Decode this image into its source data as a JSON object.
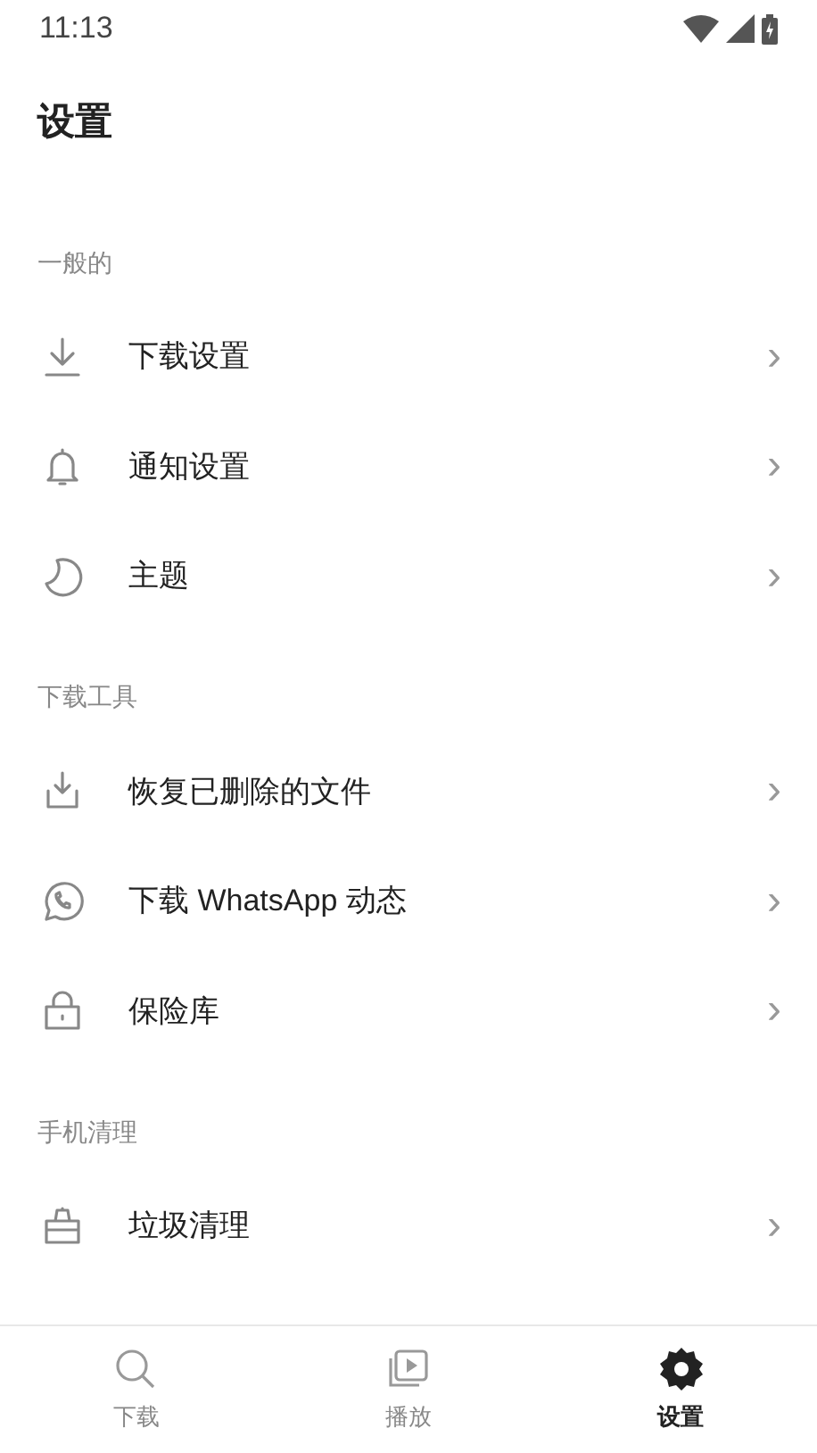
{
  "status_bar": {
    "time": "11:13"
  },
  "title": "设置",
  "sections": [
    {
      "heading": "一般的",
      "items": [
        {
          "label": "下载设置",
          "chevron": "›"
        },
        {
          "label": "通知设置",
          "chevron": "›"
        },
        {
          "label": "主题",
          "chevron": "›"
        }
      ]
    },
    {
      "heading": "下载工具",
      "items": [
        {
          "label": "恢复已删除的文件",
          "chevron": "›"
        },
        {
          "label": "下载 WhatsApp 动态",
          "chevron": "›"
        },
        {
          "label": "保险库",
          "chevron": "›"
        }
      ]
    },
    {
      "heading": "手机清理",
      "items": [
        {
          "label": "垃圾清理",
          "chevron": "›"
        }
      ]
    }
  ],
  "bottom_nav": [
    {
      "label": "下载",
      "selected": false
    },
    {
      "label": "播放",
      "selected": false
    },
    {
      "label": "设置",
      "selected": true
    }
  ]
}
